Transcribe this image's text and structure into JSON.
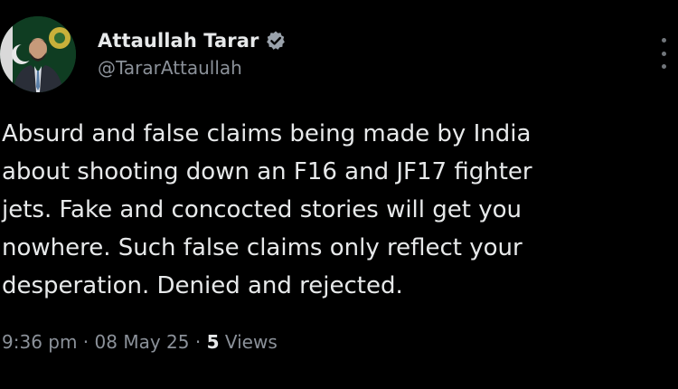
{
  "author": {
    "display_name": "Attaullah Tarar",
    "handle": "@TararAttaullah",
    "verified": true
  },
  "tweet": {
    "text_lines": [
      "Absurd and false claims being made by India",
      "about shooting down an F16 and JF17 fighter",
      "jets. Fake and concocted stories will get you",
      "nowhere. Such false claims only reflect your",
      "desperation. Denied and rejected."
    ]
  },
  "meta": {
    "time": "9:36 pm",
    "separator": " · ",
    "date": "08 May 25",
    "views_count": "5",
    "views_label": " Views"
  },
  "colors": {
    "background": "#000000",
    "text_primary": "#e7e9ea",
    "text_secondary": "#8b9199",
    "verified_badge": "#9aa2ab",
    "avatar_background": "#0f3d22"
  },
  "icons": {
    "verified": "verified-badge-icon",
    "more": "more-vertical-icon"
  }
}
